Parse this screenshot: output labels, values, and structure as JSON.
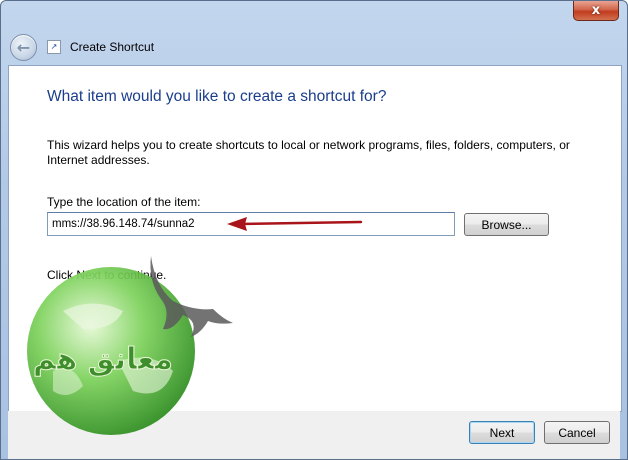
{
  "window": {
    "title": "Create Shortcut",
    "close_glyph": "x",
    "back_icon": "back-arrow-icon"
  },
  "wizard": {
    "heading": "What item would you like to create a shortcut for?",
    "description": "This wizard helps you to create shortcuts to local or network programs, files, folders, computers, or Internet addresses.",
    "location_label": "Type the location of the item:",
    "location_value": "mms://38.96.148.74/sunna2",
    "browse_label": "Browse...",
    "continue_text": "Click Next to continue."
  },
  "footer": {
    "next_label": "Next",
    "cancel_label": "Cancel"
  },
  "overlay": {
    "arrow_color": "#a8141a",
    "watermark_text": "معانق هم",
    "watermark_color": "#3e8e2c"
  }
}
